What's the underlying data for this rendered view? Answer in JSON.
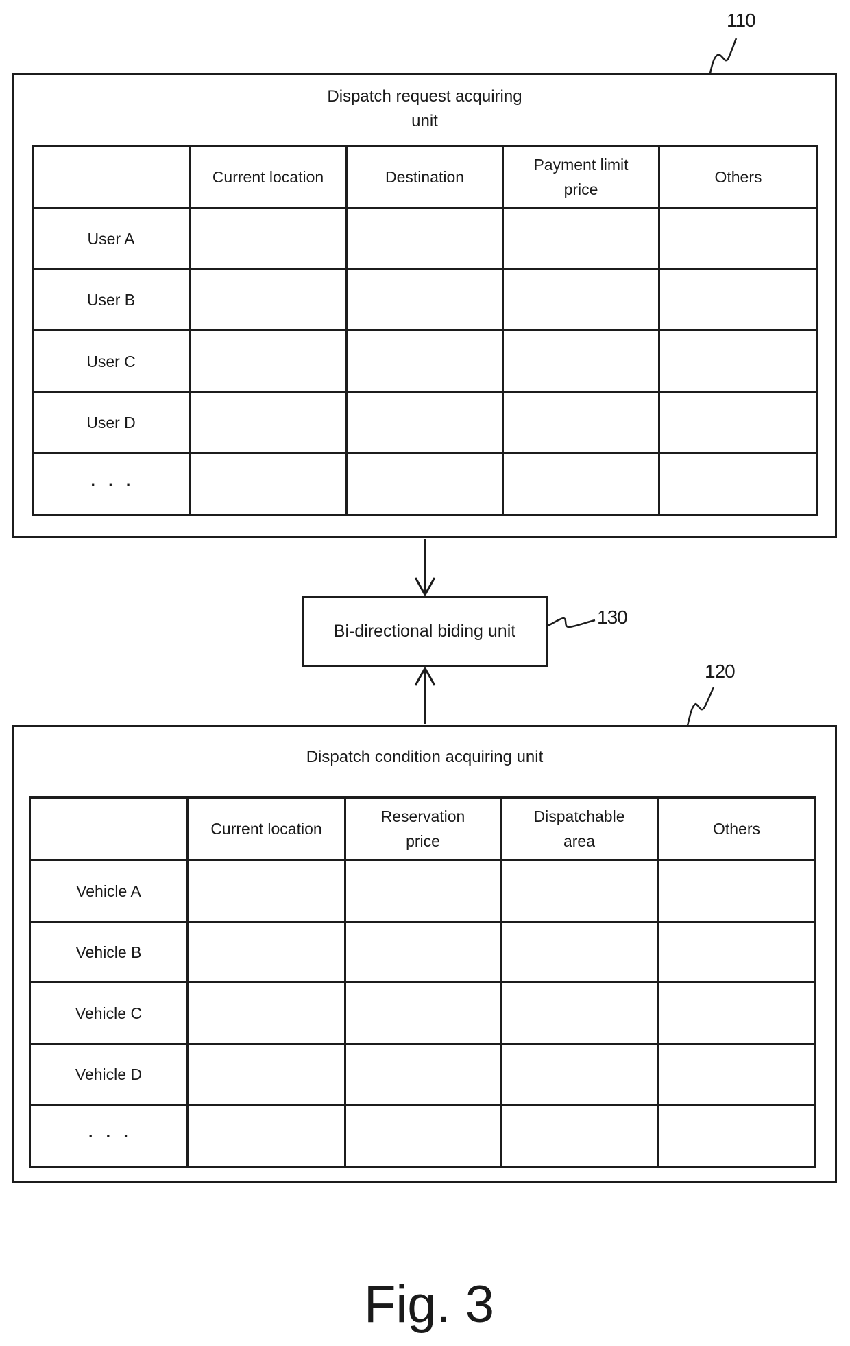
{
  "request_unit": {
    "ref": "110",
    "title": "Dispatch request acquiring\nunit",
    "columns": [
      "",
      "Current location",
      "Destination",
      "Payment limit\nprice",
      "Others"
    ],
    "rows": [
      {
        "label": "User A",
        "cells": [
          "",
          "",
          "",
          ""
        ]
      },
      {
        "label": "User B",
        "cells": [
          "",
          "",
          "",
          ""
        ]
      },
      {
        "label": "User C",
        "cells": [
          "",
          "",
          "",
          ""
        ]
      },
      {
        "label": "User D",
        "cells": [
          "",
          "",
          "",
          ""
        ]
      },
      {
        "label": "···",
        "cells": [
          "",
          "",
          "",
          ""
        ]
      }
    ]
  },
  "bidding_unit": {
    "ref": "130",
    "label": "Bi-directional biding unit"
  },
  "condition_unit": {
    "ref": "120",
    "title": "Dispatch condition acquiring unit",
    "columns": [
      "",
      "Current location",
      "Reservation\nprice",
      "Dispatchable\narea",
      "Others"
    ],
    "rows": [
      {
        "label": "Vehicle A",
        "cells": [
          "",
          "",
          "",
          ""
        ]
      },
      {
        "label": "Vehicle B",
        "cells": [
          "",
          "",
          "",
          ""
        ]
      },
      {
        "label": "Vehicle C",
        "cells": [
          "",
          "",
          "",
          ""
        ]
      },
      {
        "label": "Vehicle D",
        "cells": [
          "",
          "",
          "",
          ""
        ]
      },
      {
        "label": "···",
        "cells": [
          "",
          "",
          "",
          ""
        ]
      }
    ]
  },
  "arrows": [
    {
      "from": "110",
      "to": "130",
      "icon": "arrow-down-icon"
    },
    {
      "from": "120",
      "to": "130",
      "icon": "arrow-up-icon"
    }
  ],
  "caption": "Fig. 3"
}
